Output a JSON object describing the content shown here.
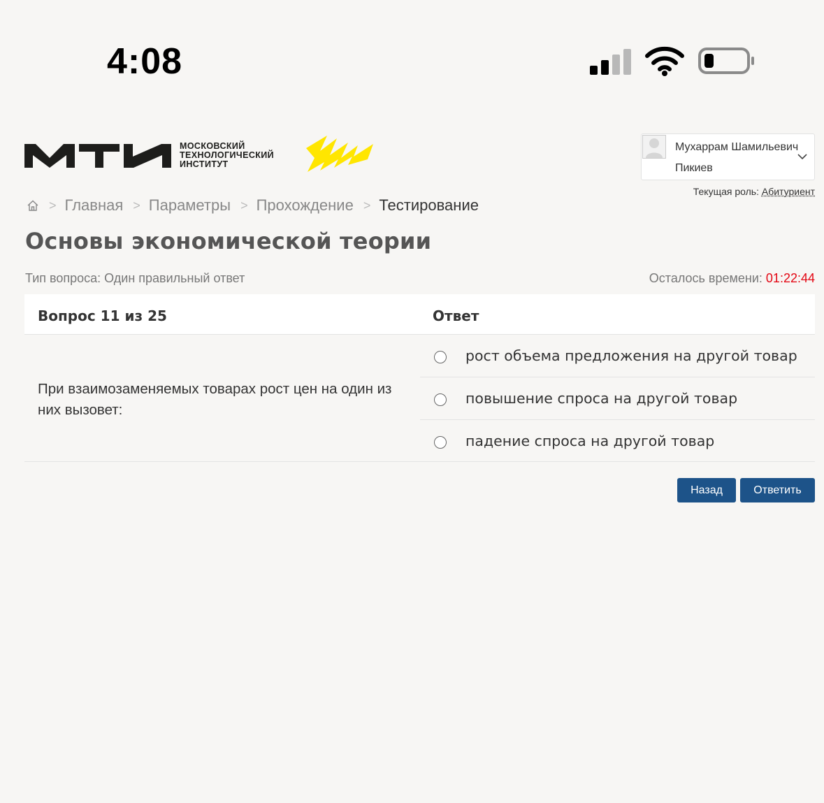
{
  "status_bar": {
    "time": "4:08",
    "signal_icon": "cellular-signal-icon",
    "wifi_icon": "wifi-icon",
    "battery_icon": "battery-low-icon"
  },
  "header": {
    "logo": {
      "mark": "МТИ",
      "text_lines": [
        "МОСКОВСКИЙ",
        "ТЕХНОЛОГИЧЕСКИЙ",
        "ИНСТИТУТ"
      ],
      "accent_color": "#ffe600"
    },
    "user": {
      "name_line1": "Мухаррам Шамильевич",
      "name_line2": "Пикиев",
      "avatar_icon": "user-avatar-icon",
      "dropdown_icon": "chevron-down-icon"
    },
    "role_label": "Текущая роль:",
    "role_value": "Абитуриент"
  },
  "breadcrumb": {
    "home_icon": "home-icon",
    "items": [
      "Главная",
      "Параметры",
      "Прохождение"
    ],
    "current": "Тестирование"
  },
  "page_title": "Основы экономической теории",
  "question_type": "Тип вопроса: Один правильный ответ",
  "timer": {
    "label": "Осталось времени:",
    "value": "01:22:44",
    "color": "#e30613"
  },
  "quiz": {
    "question_header": "Вопрос 11 из 25",
    "answer_header": "Ответ",
    "question_text": "При взаимозаменяемых товарах рост цен на один из них вызовет:",
    "answers": [
      "рост объема предложения на другой товар",
      "повышение спроса на другой товар",
      "падение спроса на другой товар"
    ]
  },
  "buttons": {
    "back": "Назад",
    "answer": "Ответить",
    "color": "#1d5389"
  }
}
